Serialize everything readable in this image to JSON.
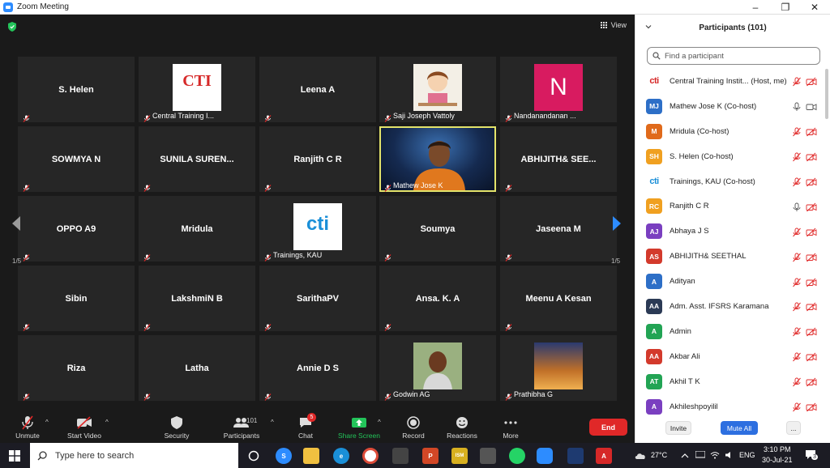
{
  "window": {
    "title": "Zoom Meeting",
    "minimize": "–",
    "maximize": "❐",
    "close": "✕"
  },
  "video": {
    "view_label": "View",
    "page_left": "1/5",
    "page_right": "1/5",
    "tiles": [
      {
        "name": "S. Helen"
      },
      {
        "label": "Central Training I...",
        "pic": "cti-logo"
      },
      {
        "name": "Leena A"
      },
      {
        "label": "Saji Joseph Vattoly",
        "pic": "cartoon"
      },
      {
        "label": "Nandanandanan ...",
        "pic": "letter",
        "letter": "N"
      },
      {
        "name": "SOWMYA N"
      },
      {
        "name": "SUNILA SUREN..."
      },
      {
        "name": "Ranjith C R"
      },
      {
        "label": "Mathew Jose K",
        "pic": "video",
        "active": true
      },
      {
        "name": "ABHIJITH& SEE..."
      },
      {
        "name": "OPPO A9"
      },
      {
        "name": "Mridula"
      },
      {
        "label": "Trainings, KAU",
        "pic": "cti2-logo"
      },
      {
        "name": "Soumya"
      },
      {
        "name": "Jaseena M"
      },
      {
        "name": "Sibin"
      },
      {
        "name": "LakshmiN B"
      },
      {
        "name": "SarithaPV"
      },
      {
        "name": "Ansa. K. A"
      },
      {
        "name": "Meenu A Kesan"
      },
      {
        "name": "Riza"
      },
      {
        "name": "Latha"
      },
      {
        "name": "Annie D S"
      },
      {
        "label": "Godwin AG",
        "pic": "photo"
      },
      {
        "label": "Prathibha G",
        "pic": "building"
      }
    ],
    "logos": {
      "cti": "CTI",
      "cti2": "cti"
    }
  },
  "toolbar": {
    "unmute": "Unmute",
    "start_video": "Start Video",
    "security": "Security",
    "participants": "Participants",
    "participants_count": "101",
    "chat": "Chat",
    "chat_badge": "5",
    "share_screen": "Share Screen",
    "record": "Record",
    "reactions": "Reactions",
    "more": "More",
    "end": "End"
  },
  "panel": {
    "title": "Participants (101)",
    "search_placeholder": "Find a participant",
    "invite": "Invite",
    "mute_all": "Mute All",
    "more": "...",
    "participants": [
      {
        "initials": "cti",
        "name": "Central Training Instit... (Host, me)",
        "color": "#ffffff",
        "logo": true,
        "mic": "muted",
        "cam": "off"
      },
      {
        "initials": "MJ",
        "name": "Mathew Jose K (Co-host)",
        "color": "#2d6fc7",
        "mic": "on",
        "cam": "on"
      },
      {
        "initials": "M",
        "name": "Mridula (Co-host)",
        "color": "#e06a1b",
        "mic": "muted",
        "cam": "off"
      },
      {
        "initials": "SH",
        "name": "S. Helen (Co-host)",
        "color": "#f0a020",
        "mic": "muted",
        "cam": "off"
      },
      {
        "initials": "cti",
        "name": "Trainings, KAU (Co-host)",
        "color": "#ffffff",
        "logo": true,
        "mic": "muted",
        "cam": "off"
      },
      {
        "initials": "RC",
        "name": "Ranjith C R",
        "color": "#f0a020",
        "mic": "on",
        "cam": "off"
      },
      {
        "initials": "AJ",
        "name": "Abhaya J S",
        "color": "#7a3fc0",
        "mic": "muted",
        "cam": "off"
      },
      {
        "initials": "AS",
        "name": "ABHIJITH& SEETHAL",
        "color": "#d33a2c",
        "mic": "muted",
        "cam": "off"
      },
      {
        "initials": "A",
        "name": "Adityan",
        "color": "#2d6fc7",
        "mic": "muted",
        "cam": "off"
      },
      {
        "initials": "AA",
        "name": "Adm. Asst. IFSRS Karamana",
        "color": "#2b3a55",
        "mic": "muted",
        "cam": "off"
      },
      {
        "initials": "A",
        "name": "Admin",
        "color": "#22a454",
        "mic": "muted",
        "cam": "off"
      },
      {
        "initials": "AA",
        "name": "Akbar Ali",
        "color": "#d33a2c",
        "mic": "muted",
        "cam": "off"
      },
      {
        "initials": "AT",
        "name": "Akhil T K",
        "color": "#22a454",
        "mic": "muted",
        "cam": "off"
      },
      {
        "initials": "A",
        "name": "Akhileshpoyilil",
        "color": "#7a3fc0",
        "mic": "muted",
        "cam": "off"
      }
    ]
  },
  "taskbar": {
    "search_placeholder": "Type here to search",
    "temperature": "27°C",
    "language": "ENG",
    "time": "3:10 PM",
    "date": "30-Jul-21",
    "notification_count": "3"
  }
}
